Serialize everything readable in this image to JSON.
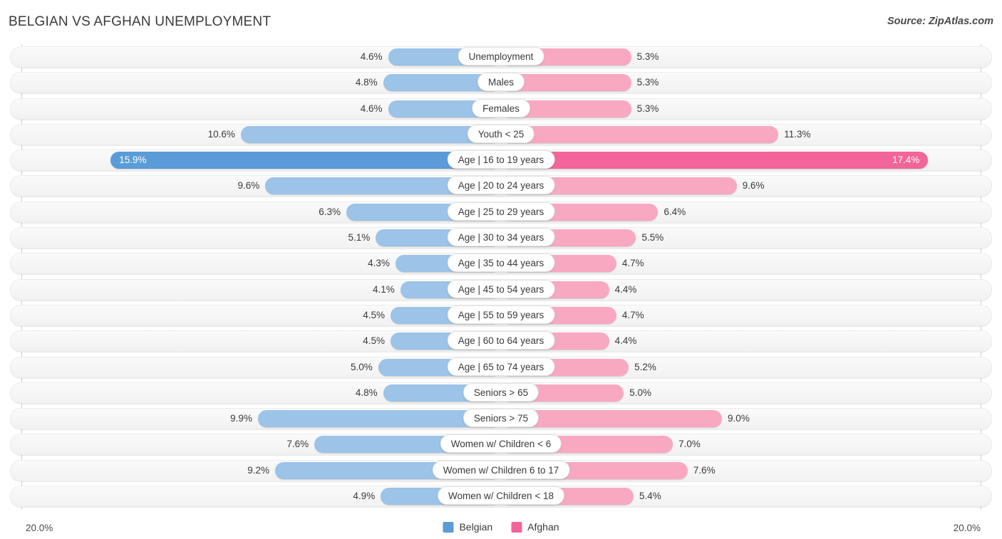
{
  "header": {
    "title": "BELGIAN VS AFGHAN UNEMPLOYMENT",
    "source": "Source: ZipAtlas.com"
  },
  "footer": {
    "axis_min": "20.0%",
    "axis_max": "20.0%",
    "legend": [
      {
        "label": "Belgian",
        "color": "#5b9bd8"
      },
      {
        "label": "Afghan",
        "color": "#f2649a"
      }
    ]
  },
  "colors": {
    "belgian_light": "#9cc3e8",
    "belgian_dark": "#5b9bd8",
    "afghan_light": "#f9a8c2",
    "afghan_dark": "#f2649a",
    "track": "#f5f5f5",
    "axis": "#d0d0d0"
  },
  "chart_data": {
    "type": "bar",
    "subtype": "diverging-bidirectional",
    "title": "BELGIAN VS AFGHAN UNEMPLOYMENT",
    "source": "Source: ZipAtlas.com",
    "xlabel": "",
    "ylabel": "",
    "unit": "%",
    "axis_max": 20.0,
    "xlim": [
      20.0,
      20.0
    ],
    "grid": false,
    "legend_position": "bottom-center",
    "categories": [
      "Unemployment",
      "Males",
      "Females",
      "Youth < 25",
      "Age | 16 to 19 years",
      "Age | 20 to 24 years",
      "Age | 25 to 29 years",
      "Age | 30 to 34 years",
      "Age | 35 to 44 years",
      "Age | 45 to 54 years",
      "Age | 55 to 59 years",
      "Age | 60 to 64 years",
      "Age | 65 to 74 years",
      "Seniors > 65",
      "Seniors > 75",
      "Women w/ Children < 6",
      "Women w/ Children 6 to 17",
      "Women w/ Children < 18"
    ],
    "series": [
      {
        "name": "Belgian",
        "side": "left",
        "color": "#9cc3e8",
        "values": [
          4.6,
          4.8,
          4.6,
          10.6,
          15.9,
          9.6,
          6.3,
          5.1,
          4.3,
          4.1,
          4.5,
          4.5,
          5.0,
          4.8,
          9.9,
          7.6,
          9.2,
          4.9
        ]
      },
      {
        "name": "Afghan",
        "side": "right",
        "color": "#f9a8c2",
        "values": [
          5.3,
          5.3,
          5.3,
          11.3,
          17.4,
          9.6,
          6.4,
          5.5,
          4.7,
          4.4,
          4.7,
          4.4,
          5.2,
          5.0,
          9.0,
          7.0,
          7.6,
          5.4
        ]
      }
    ]
  },
  "rows": [
    {
      "label": "Unemployment",
      "left": "4.6%",
      "right": "5.3%",
      "left_value": 4.6,
      "right_value": 5.3,
      "highlight": false
    },
    {
      "label": "Males",
      "left": "4.8%",
      "right": "5.3%",
      "left_value": 4.8,
      "right_value": 5.3,
      "highlight": false
    },
    {
      "label": "Females",
      "left": "4.6%",
      "right": "5.3%",
      "left_value": 4.6,
      "right_value": 5.3,
      "highlight": false
    },
    {
      "label": "Youth < 25",
      "left": "10.6%",
      "right": "11.3%",
      "left_value": 10.6,
      "right_value": 11.3,
      "highlight": false
    },
    {
      "label": "Age | 16 to 19 years",
      "left": "15.9%",
      "right": "17.4%",
      "left_value": 15.9,
      "right_value": 17.4,
      "highlight": true
    },
    {
      "label": "Age | 20 to 24 years",
      "left": "9.6%",
      "right": "9.6%",
      "left_value": 9.6,
      "right_value": 9.6,
      "highlight": false
    },
    {
      "label": "Age | 25 to 29 years",
      "left": "6.3%",
      "right": "6.4%",
      "left_value": 6.3,
      "right_value": 6.4,
      "highlight": false
    },
    {
      "label": "Age | 30 to 34 years",
      "left": "5.1%",
      "right": "5.5%",
      "left_value": 5.1,
      "right_value": 5.5,
      "highlight": false
    },
    {
      "label": "Age | 35 to 44 years",
      "left": "4.3%",
      "right": "4.7%",
      "left_value": 4.3,
      "right_value": 4.7,
      "highlight": false
    },
    {
      "label": "Age | 45 to 54 years",
      "left": "4.1%",
      "right": "4.4%",
      "left_value": 4.1,
      "right_value": 4.4,
      "highlight": false
    },
    {
      "label": "Age | 55 to 59 years",
      "left": "4.5%",
      "right": "4.7%",
      "left_value": 4.5,
      "right_value": 4.7,
      "highlight": false
    },
    {
      "label": "Age | 60 to 64 years",
      "left": "4.5%",
      "right": "4.4%",
      "left_value": 4.5,
      "right_value": 4.4,
      "highlight": false
    },
    {
      "label": "Age | 65 to 74 years",
      "left": "5.0%",
      "right": "5.2%",
      "left_value": 5.0,
      "right_value": 5.2,
      "highlight": false
    },
    {
      "label": "Seniors > 65",
      "left": "4.8%",
      "right": "5.0%",
      "left_value": 4.8,
      "right_value": 5.0,
      "highlight": false
    },
    {
      "label": "Seniors > 75",
      "left": "9.9%",
      "right": "9.0%",
      "left_value": 9.9,
      "right_value": 9.0,
      "highlight": false
    },
    {
      "label": "Women w/ Children < 6",
      "left": "7.6%",
      "right": "7.0%",
      "left_value": 7.6,
      "right_value": 7.0,
      "highlight": false
    },
    {
      "label": "Women w/ Children 6 to 17",
      "left": "9.2%",
      "right": "7.6%",
      "left_value": 9.2,
      "right_value": 7.6,
      "highlight": false
    },
    {
      "label": "Women w/ Children < 18",
      "left": "4.9%",
      "right": "5.4%",
      "left_value": 4.9,
      "right_value": 5.4,
      "highlight": false
    }
  ]
}
